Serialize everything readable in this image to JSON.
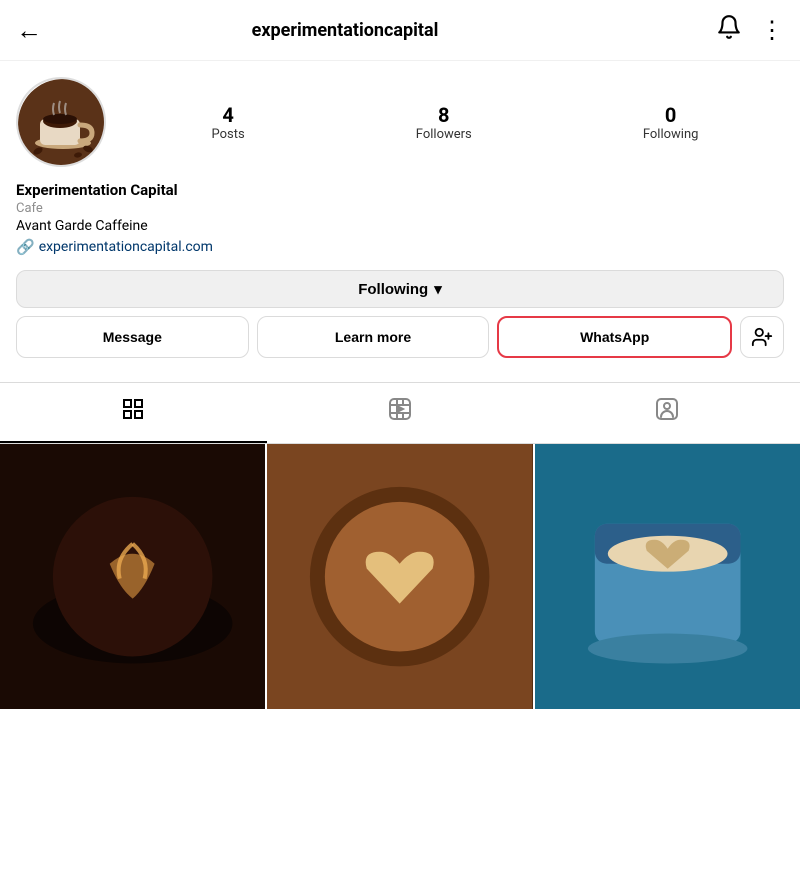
{
  "header": {
    "title": "experimentationcapital",
    "back_label": "←",
    "bell_icon": "🔔",
    "menu_icon": "⋮"
  },
  "profile": {
    "name": "Experimentation Capital",
    "category": "Cafe",
    "tagline": "Avant Garde Caffeine",
    "website": "experimentationcapital.com",
    "stats": {
      "posts": {
        "count": "4",
        "label": "Posts"
      },
      "followers": {
        "count": "8",
        "label": "Followers"
      },
      "following": {
        "count": "0",
        "label": "Following"
      }
    }
  },
  "buttons": {
    "following": "Following",
    "chevron": "▾",
    "message": "Message",
    "learn_more": "Learn more",
    "whatsapp": "WhatsApp",
    "add_person": "👤+"
  },
  "tabs": {
    "grid_icon": "⊞",
    "reels_icon": "▶",
    "tagged_icon": "👤"
  }
}
